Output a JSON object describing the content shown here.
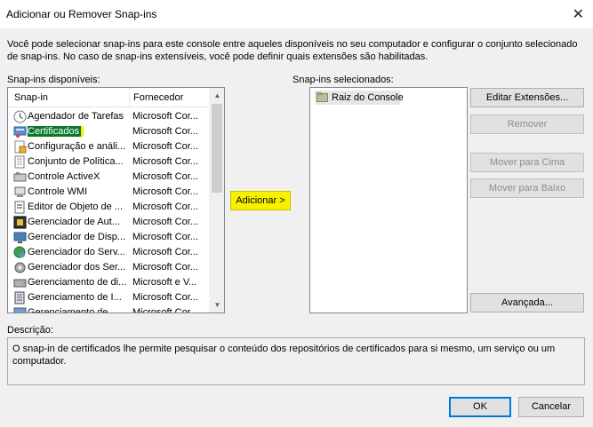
{
  "window": {
    "title": "Adicionar ou Remover Snap-ins",
    "close_glyph": "✕"
  },
  "intro_text": "Você pode selecionar snap-ins para este console entre aqueles disponíveis no seu computador e configurar o conjunto selecionado de snap-ins. No caso de snap-ins extensíveis, você pode definir quais extensões são habilitadas.",
  "available": {
    "label": "Snap-ins disponíveis:",
    "col_snapin": "Snap-in",
    "col_vendor": "Fornecedor",
    "items": [
      {
        "name": "Agendador de Tarefas",
        "vendor": "Microsoft Cor...",
        "icon": "clock-icon"
      },
      {
        "name": "Certificados",
        "vendor": "Microsoft Cor...",
        "icon": "certificate-icon",
        "selected": true
      },
      {
        "name": "Configuração e análi...",
        "vendor": "Microsoft Cor...",
        "icon": "security-config-icon"
      },
      {
        "name": "Conjunto de Política...",
        "vendor": "Microsoft Cor...",
        "icon": "policy-icon"
      },
      {
        "name": "Controle ActiveX",
        "vendor": "Microsoft Cor...",
        "icon": "activex-icon"
      },
      {
        "name": "Controle WMI",
        "vendor": "Microsoft Cor...",
        "icon": "wmi-icon"
      },
      {
        "name": "Editor de Objeto de ...",
        "vendor": "Microsoft Cor...",
        "icon": "gpo-editor-icon"
      },
      {
        "name": "Gerenciador de Aut...",
        "vendor": "Microsoft Cor...",
        "icon": "authorization-icon"
      },
      {
        "name": "Gerenciador de Disp...",
        "vendor": "Microsoft Cor...",
        "icon": "device-manager-icon"
      },
      {
        "name": "Gerenciador do Serv...",
        "vendor": "Microsoft Cor...",
        "icon": "server-manager-icon"
      },
      {
        "name": "Gerenciador dos Ser...",
        "vendor": "Microsoft Cor...",
        "icon": "services-icon"
      },
      {
        "name": "Gerenciamento de di...",
        "vendor": "Microsoft e V...",
        "icon": "disk-management-icon"
      },
      {
        "name": "Gerenciamento de I...",
        "vendor": "Microsoft Cor...",
        "icon": "print-management-icon"
      },
      {
        "name": "Gerenciamento de ...",
        "vendor": "Microsoft Cor...",
        "icon": "computer-management-icon"
      }
    ]
  },
  "add_button": "Adicionar >",
  "selected": {
    "label": "Snap-ins selecionados:",
    "items": [
      {
        "name": "Raiz do Console",
        "icon": "folder-icon"
      }
    ]
  },
  "buttons": {
    "edit_extensions": "Editar Extensões...",
    "remove": "Remover",
    "move_up": "Mover para Cima",
    "move_down": "Mover para Baixo",
    "advanced": "Avançada...",
    "ok": "OK",
    "cancel": "Cancelar"
  },
  "description": {
    "label": "Descrição:",
    "text": "O snap-in de certificados lhe permite pesquisar o conteúdo dos repositórios de certificados para si mesmo, um serviço ou um computador."
  },
  "colors": {
    "selection_bg": "#0a7a2a",
    "highlight_yellow": "#f8f000",
    "default_button_border": "#0078d7"
  }
}
